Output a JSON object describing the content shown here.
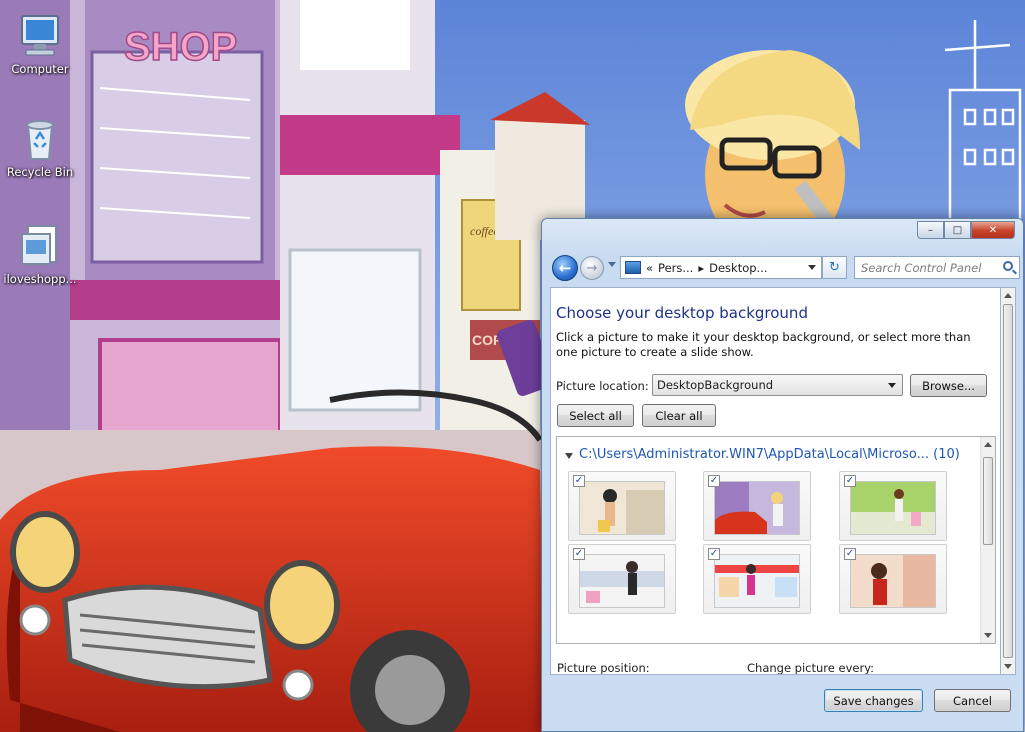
{
  "desktop": {
    "wallpaper_texts": {
      "shop_sign": "SHOP",
      "cafe_sign": "coffee",
      "cafe_awning": "COFFEE"
    },
    "icons": [
      {
        "label": "Computer",
        "icon": "computer-icon"
      },
      {
        "label": "Recycle Bin",
        "icon": "recycle-bin-icon"
      },
      {
        "label": "iloveshopp...",
        "icon": "document-icon"
      }
    ]
  },
  "window": {
    "caption_buttons": {
      "minimize": "–",
      "maximize": "□",
      "close": "✕"
    },
    "nav": {
      "back_icon": "back-arrow-icon",
      "forward_icon": "forward-arrow-icon",
      "address_prefix": "«",
      "address_parts": [
        "Pers...",
        "Desktop..."
      ],
      "separator": "▸",
      "refresh_symbol": "↻",
      "search_placeholder": "Search Control Panel"
    },
    "content": {
      "title": "Choose your desktop background",
      "description": "Click a picture to make it your desktop background, or select more than one picture to create a slide show.",
      "picture_location_label": "Picture location:",
      "picture_location_value": "DesktopBackground",
      "browse_label": "Browse...",
      "select_all_label": "Select all",
      "clear_all_label": "Clear all",
      "folder_path": "C:\\Users\\Administrator.WIN7\\AppData\\Local\\Microso... (10)",
      "thumbnails": [
        {
          "checked": true,
          "theme": "woman-with-hat-and-bags"
        },
        {
          "checked": true,
          "theme": "red-car-shopping"
        },
        {
          "checked": true,
          "theme": "woman-shopping-green"
        },
        {
          "checked": true,
          "theme": "woman-city-street"
        },
        {
          "checked": true,
          "theme": "supermarket-cart"
        },
        {
          "checked": true,
          "theme": "woman-in-red-store"
        }
      ],
      "picture_position_label": "Picture position:",
      "change_picture_label": "Change picture every:"
    },
    "footer": {
      "save_label": "Save changes",
      "cancel_label": "Cancel"
    }
  }
}
